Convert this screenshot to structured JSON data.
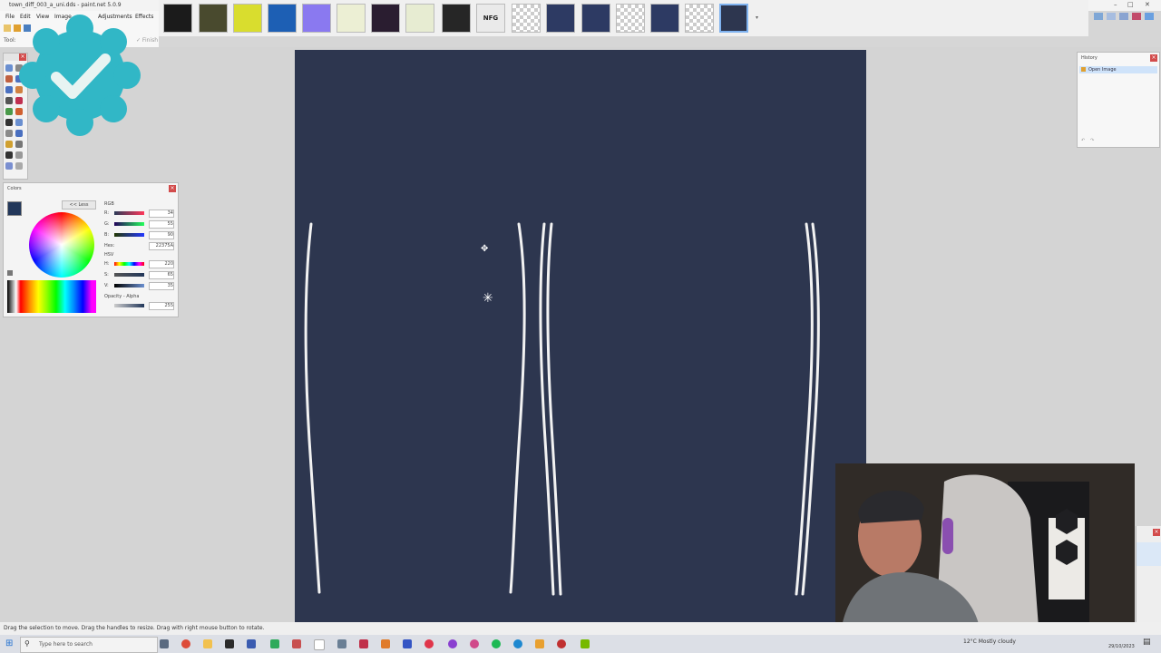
{
  "window": {
    "title": "town_diff_003_a_uni.dds - paint.net 5.0.9"
  },
  "menu": {
    "file": "File",
    "edit": "Edit",
    "view": "View",
    "image": "Image",
    "adjustments": "Adjustments",
    "effects": "Effects"
  },
  "toolbar": {
    "tool_label": "Tool:",
    "finish_label": "✓ Finish"
  },
  "thumbnails": [
    {
      "bg": "#1b1b1b"
    },
    {
      "bg": "#494a2e"
    },
    {
      "bg": "#d9dd2e"
    },
    {
      "bg": "#1d5fb4"
    },
    {
      "bg": "#8a79f0"
    },
    {
      "bg": "#ecefd4"
    },
    {
      "bg": "#2a1d30"
    },
    {
      "bg": "#e7ecd2"
    },
    {
      "bg": "#262626"
    },
    {
      "bg": "#eaeaea",
      "text": "NFG"
    },
    {
      "bg": "checker"
    },
    {
      "bg": "#2d3a63"
    },
    {
      "bg": "#2d3a63"
    },
    {
      "bg": "checker"
    },
    {
      "bg": "#2d3a63"
    },
    {
      "bg": "checker"
    },
    {
      "bg": "#2d364f"
    }
  ],
  "colors_panel": {
    "title": "Colors",
    "less_button": "<< Less",
    "rgb_label": "RGB",
    "r_label": "R:",
    "g_label": "G:",
    "b_label": "B:",
    "r_value": "34",
    "g_value": "55",
    "b_value": "90",
    "hex_label": "Hex:",
    "hex_value": "22375A",
    "hsv_label": "HSV",
    "h_label": "H:",
    "s_label": "S:",
    "v_label": "V:",
    "h_value": "220",
    "s_value": "65",
    "v_value": "35",
    "opacity_label": "Opacity - Alpha",
    "opacity_value": "255",
    "primary_color": "#22375a"
  },
  "history_panel": {
    "title": "History",
    "item": "Open Image"
  },
  "status": {
    "hint": "Drag the selection to move. Drag the handles to resize. Drag with right mouse button to rotate."
  },
  "taskbar": {
    "search_placeholder": "Type here to search",
    "weather": "12°C  Mostly cloudy",
    "date": "29/10/2023"
  },
  "canvas": {
    "background": "#2d364f",
    "stripe_color": "#f2f2f2"
  }
}
